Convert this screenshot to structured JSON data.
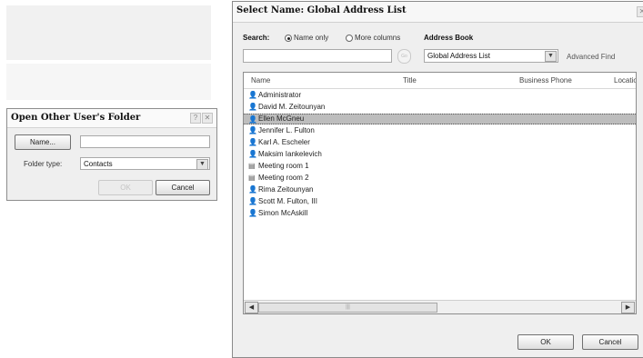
{
  "open_folder_dialog": {
    "title": "Open Other User's Folder",
    "name_button": "Name...",
    "name_value": "",
    "folder_type_label": "Folder type:",
    "folder_type_value": "Contacts",
    "ok_button": "OK",
    "cancel_button": "Cancel"
  },
  "select_name_dialog": {
    "title": "Select Name: Global Address List",
    "search_label": "Search:",
    "radio_name_only": "Name only",
    "radio_more_columns": "More columns",
    "address_book_label": "Address Book",
    "search_value": "",
    "go_button": "Go",
    "address_book_value": "Global Address List",
    "advanced_find": "Advanced Find",
    "columns": [
      "Name",
      "Title",
      "Business Phone",
      "Location"
    ],
    "entries": [
      {
        "name": "Administrator",
        "icon": "person-icon",
        "selected": false
      },
      {
        "name": "David M. Zeitounyan",
        "icon": "person-icon",
        "selected": false
      },
      {
        "name": "Ellen McGneu",
        "icon": "person-icon",
        "selected": true
      },
      {
        "name": "Jennifer L. Fulton",
        "icon": "person-icon",
        "selected": false
      },
      {
        "name": "Karl A. Escheler",
        "icon": "person-icon",
        "selected": false
      },
      {
        "name": "Maksim Iankelevich",
        "icon": "person-icon",
        "selected": false
      },
      {
        "name": "Meeting room 1",
        "icon": "room-icon",
        "selected": false
      },
      {
        "name": "Meeting room 2",
        "icon": "room-icon",
        "selected": false
      },
      {
        "name": "Rima Zeitounyan",
        "icon": "person-icon",
        "selected": false
      },
      {
        "name": "Scott M. Fulton, III",
        "icon": "person-icon",
        "selected": false
      },
      {
        "name": "Simon McAskill",
        "icon": "person-icon",
        "selected": false
      }
    ],
    "ok_button": "OK",
    "cancel_button": "Cancel"
  }
}
